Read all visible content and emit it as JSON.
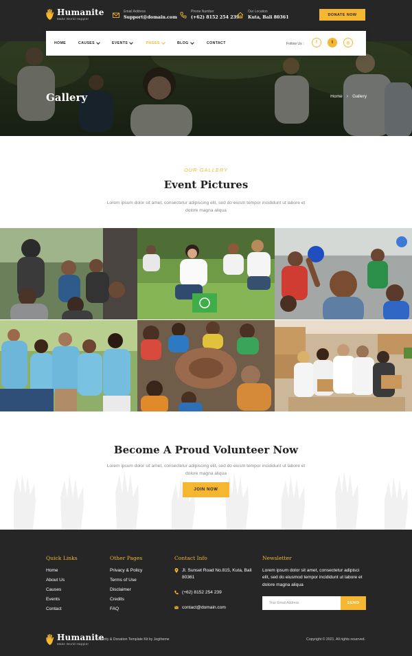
{
  "brand": {
    "name": "Humanite",
    "tagline": "Make World Happier"
  },
  "topbar": {
    "email": {
      "label": "Email Address",
      "value": "Support@domain.com",
      "icon": "envelope-icon"
    },
    "phone": {
      "label": "Phone Number",
      "value": "(+62) 8152 254 239",
      "icon": "phone-icon"
    },
    "location": {
      "label": "Our Location",
      "value": "Kuta, Bali 80361",
      "icon": "home-icon"
    },
    "donate_label": "DONATE NOW"
  },
  "nav": {
    "items": [
      {
        "label": "HOME",
        "dropdown": false
      },
      {
        "label": "CAUSES",
        "dropdown": true
      },
      {
        "label": "EVENTS",
        "dropdown": true
      },
      {
        "label": "PAGES",
        "dropdown": true,
        "active": true
      },
      {
        "label": "BLOG",
        "dropdown": true
      },
      {
        "label": "CONTACT",
        "dropdown": false
      }
    ],
    "follow_label": "Follow Us :",
    "social": [
      "f",
      "t",
      "◎"
    ]
  },
  "hero": {
    "title": "Gallery",
    "breadcrumb": [
      "Home",
      "Gallery"
    ]
  },
  "gallery": {
    "eyebrow": "OUR GALLERY",
    "title": "Event Pictures",
    "description": "Lorem ipsum dolor sit amet, consectetur adipiscing elit, sed do eiusm tempor incididunt ut labore et dolore magna aliqua"
  },
  "volunteer": {
    "title": "Become A Proud Volunteer Now",
    "description": "Lorem ipsum dolor sit amet, consectetur adipiscing elit, sed do eiusm tempor incididunt ut labore et dolore magna aliqua",
    "button_label": "JOIN NOW"
  },
  "footer": {
    "quick_links": {
      "heading": "Quick Links",
      "items": [
        "Home",
        "About Us",
        "Causes",
        "Events",
        "Contact"
      ]
    },
    "other_pages": {
      "heading": "Other Pages",
      "items": [
        "Privacy & Policy",
        "Terms of Use",
        "Disclaimer",
        "Credits",
        "FAQ"
      ]
    },
    "contact": {
      "heading": "Contact Info",
      "address": "Jl. Sunset Road No.815, Kuta, Bali 80361",
      "phone": "(+62) 8152 254 239",
      "email": "contact@domain.com"
    },
    "newsletter": {
      "heading": "Newsletter",
      "description": "Lorem ipsum dolor sit amet, consectetur adipisci elit, sed do eiusmod tempor incididunt ut labore et dolore magna aliqua",
      "placeholder": "Your Email Address",
      "send_label": "SEND"
    },
    "credit": "Charity & Donation Template Kit by Jegtheme",
    "copyright": "Copyright © 2021. All rights reserved."
  },
  "colors": {
    "accent": "#f5b731",
    "dark": "#262626"
  }
}
